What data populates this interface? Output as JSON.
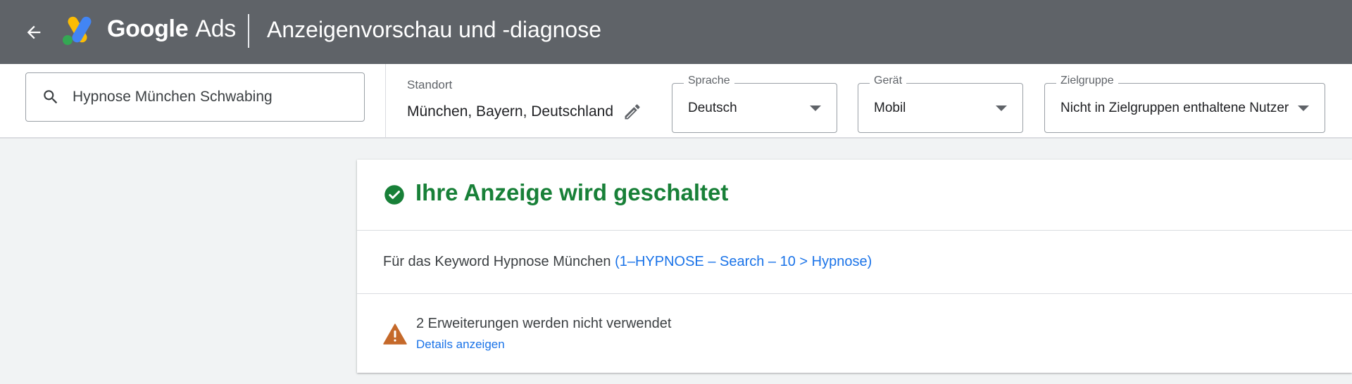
{
  "header": {
    "brand_google": "Google",
    "brand_ads": "Ads",
    "title": "Anzeigenvorschau und -diagnose",
    "back_icon": "arrow-back-icon",
    "background_color": "#5f6368"
  },
  "toolbar": {
    "search": {
      "value": "Hypnose München Schwabing",
      "icon": "search-icon"
    },
    "location": {
      "label": "Standort",
      "value": "München, Bayern, Deutschland",
      "edit_icon": "pencil-icon"
    },
    "language": {
      "label": "Sprache",
      "value": "Deutsch"
    },
    "device": {
      "label": "Gerät",
      "value": "Mobil"
    },
    "audience": {
      "label": "Zielgruppe",
      "value": "Nicht in Zielgruppen enthaltene Nutzer"
    }
  },
  "card": {
    "status": {
      "text": "Ihre Anzeige wird geschaltet",
      "icon": "check-circle-icon",
      "color": "#188038"
    },
    "keyword": {
      "prefix": "Für das Keyword Hypnose München",
      "link": "(1–HYPNOSE – Search – 10 > Hypnose)"
    },
    "warning": {
      "text": "2 Erweiterungen werden nicht verwendet",
      "link": "Details anzeigen",
      "icon": "warning-triangle-icon",
      "color": "#c5692a"
    }
  },
  "colors": {
    "link": "#1a73e8",
    "page_background": "#f1f3f4"
  }
}
